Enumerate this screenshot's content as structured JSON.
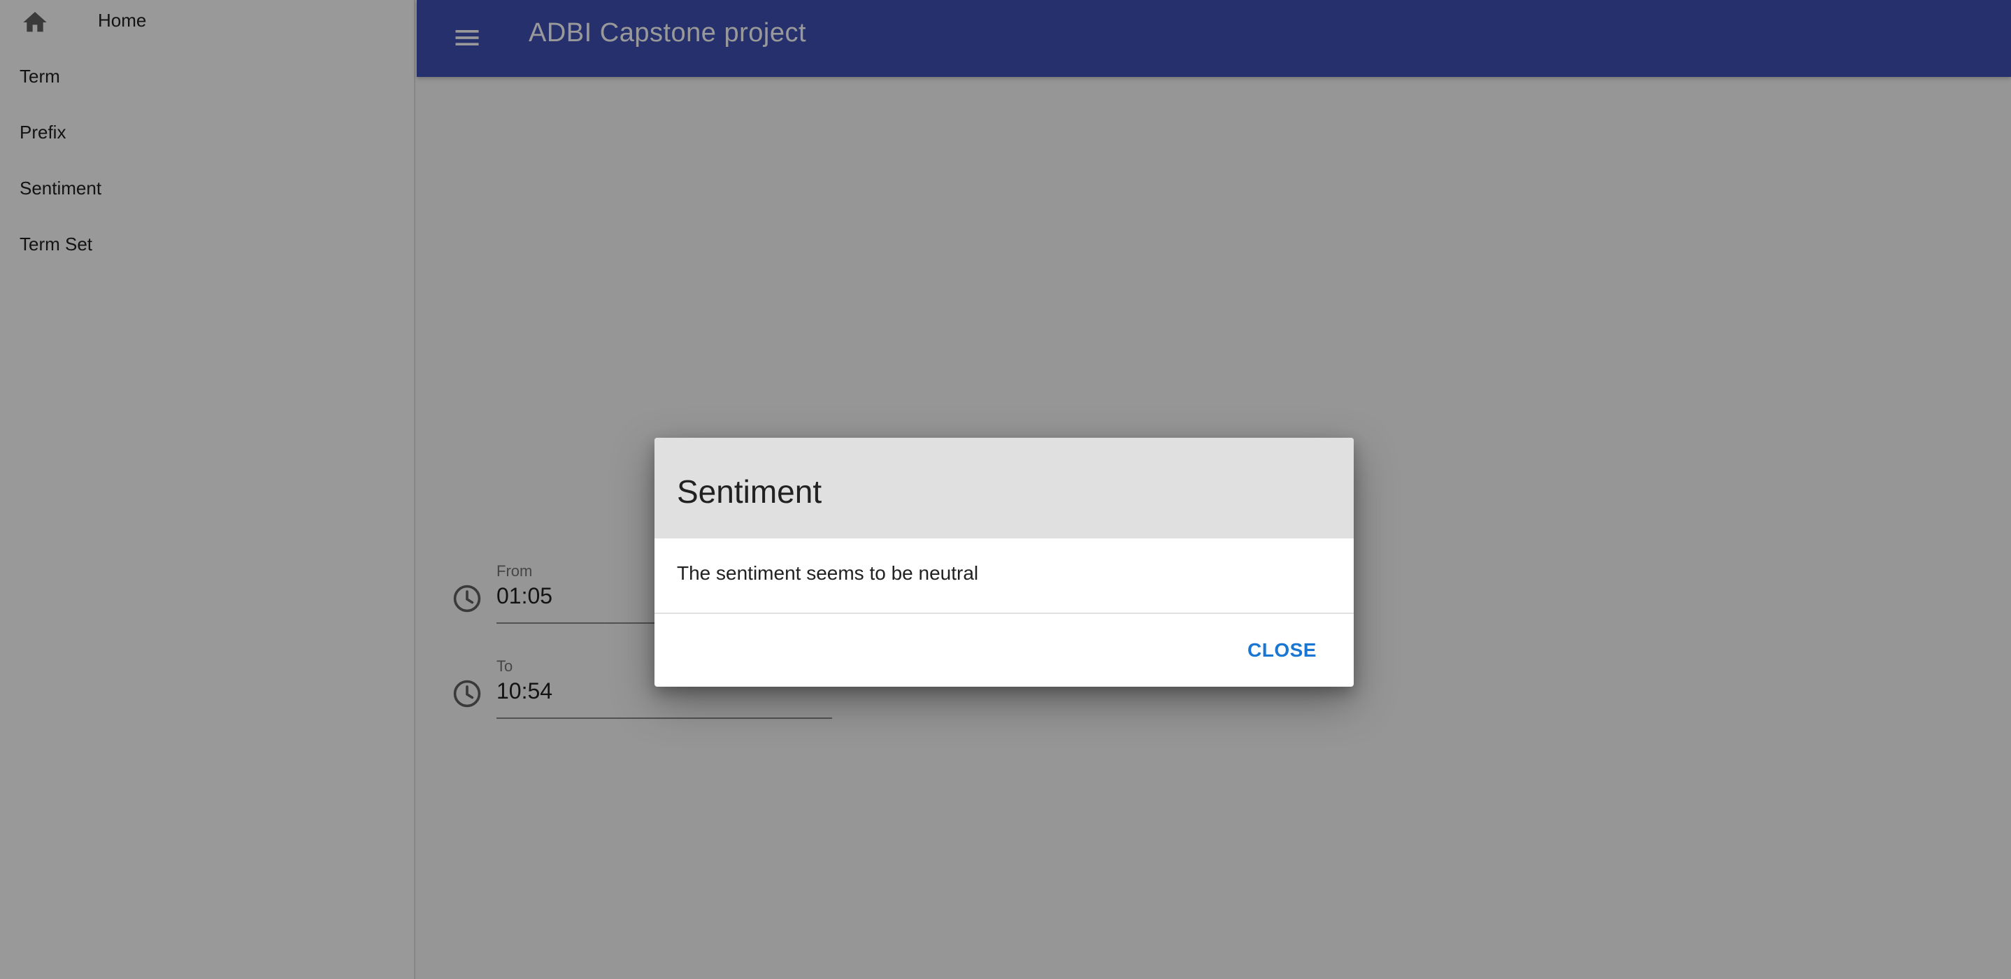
{
  "sidebar": {
    "items": [
      {
        "label": "Home",
        "icon": "home-icon"
      },
      {
        "label": "Term"
      },
      {
        "label": "Prefix"
      },
      {
        "label": "Sentiment"
      },
      {
        "label": "Term Set"
      }
    ]
  },
  "appbar": {
    "menu_icon": "menu-icon",
    "title": "ADBI Capstone project",
    "color": "#3f51b5"
  },
  "time_range": {
    "from": {
      "label": "From",
      "value": "01:05",
      "icon": "clock-icon"
    },
    "to": {
      "label": "To",
      "value": "10:54",
      "icon": "clock-icon"
    }
  },
  "dialog": {
    "title": "Sentiment",
    "message": "The sentiment seems to be neutral",
    "close_label": "CLOSE",
    "accent": "#1976d2"
  }
}
